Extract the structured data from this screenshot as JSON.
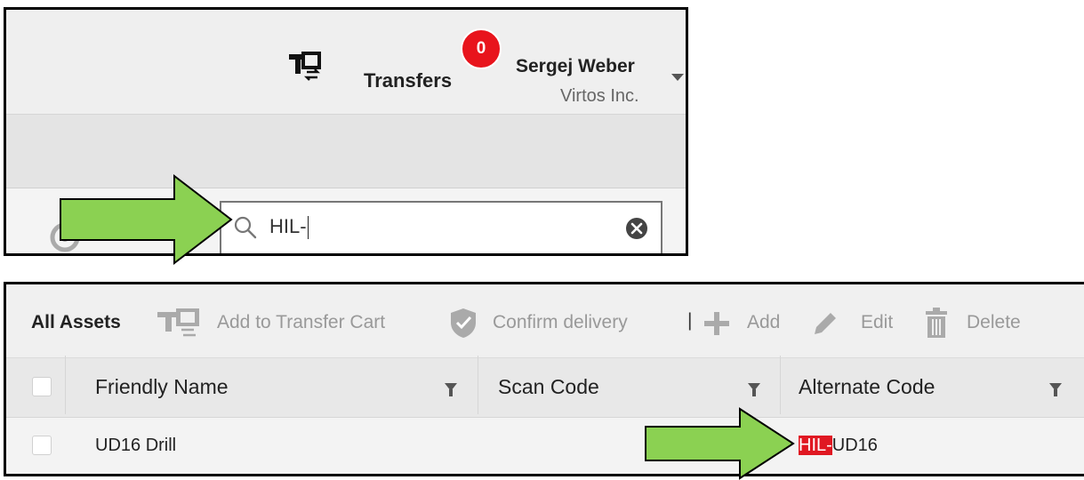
{
  "header": {
    "transfers_label": "Transfers",
    "transfers_count": "0",
    "user_name": "Sergej Weber",
    "company": "Virtos Inc."
  },
  "search": {
    "value": "HIL-",
    "placeholder": ""
  },
  "toolbar": {
    "all_assets": "All Assets",
    "add_to_cart": "Add to Transfer Cart",
    "confirm_delivery": "Confirm delivery",
    "separator": "|",
    "add": "Add",
    "edit": "Edit",
    "delete": "Delete"
  },
  "table": {
    "columns": [
      "Friendly Name",
      "Scan Code",
      "Alternate Code"
    ],
    "rows": [
      {
        "friendly_name": "UD16 Drill",
        "scan_code": "",
        "alternate_code_highlight": "HIL-",
        "alternate_code_rest": "UD16"
      }
    ]
  },
  "colors": {
    "arrow_fill": "#8bd152",
    "badge": "#e8141c",
    "highlight": "#e01822"
  },
  "icons": [
    "transfers-icon",
    "refresh-icon",
    "search-icon",
    "clear-icon",
    "cart-icon",
    "shield-check-icon",
    "plus-icon",
    "pencil-icon",
    "trash-icon",
    "filter-icon"
  ]
}
